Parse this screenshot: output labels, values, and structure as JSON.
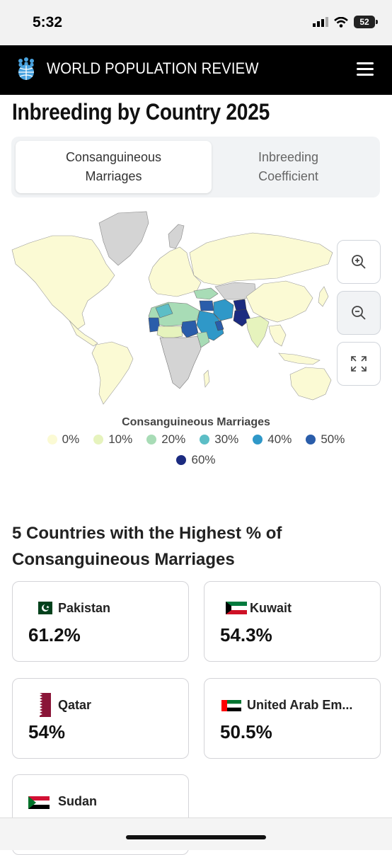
{
  "status": {
    "time": "5:32",
    "battery": "52"
  },
  "header": {
    "brand": "WORLD POPULATION REVIEW",
    "menu_icon": "hamburger-icon"
  },
  "page": {
    "title": "Inbreeding by Country 2025"
  },
  "tabs": [
    {
      "label": "Consanguineous Marriages",
      "active": true
    },
    {
      "label": "Inbreeding Coefficient",
      "active": false
    }
  ],
  "map": {
    "controls": [
      {
        "icon": "zoom-in-icon"
      },
      {
        "icon": "zoom-out-icon"
      },
      {
        "icon": "fullscreen-icon"
      }
    ],
    "legend": {
      "title": "Consanguineous Marriages",
      "items": [
        {
          "label": "0%",
          "color": "#fbfad4"
        },
        {
          "label": "10%",
          "color": "#e6f3bd"
        },
        {
          "label": "20%",
          "color": "#a8dcb6"
        },
        {
          "label": "30%",
          "color": "#5cbec6"
        },
        {
          "label": "40%",
          "color": "#2f98c8"
        },
        {
          "label": "50%",
          "color": "#2a5daa"
        },
        {
          "label": "60%",
          "color": "#1b2b80"
        }
      ]
    }
  },
  "section": {
    "heading": "5 Countries with the Highest % of Consanguineous Marriages",
    "countries": [
      {
        "name": "Pakistan",
        "value": "61.2%",
        "flag": "pakistan-flag"
      },
      {
        "name": "Kuwait",
        "value": "54.3%",
        "flag": "kuwait-flag"
      },
      {
        "name": "Qatar",
        "value": "54%",
        "flag": "qatar-flag"
      },
      {
        "name": "United Arab Em...",
        "value": "50.5%",
        "flag": "uae-flag"
      },
      {
        "name": "Sudan",
        "value": "",
        "flag": "sudan-flag"
      }
    ]
  }
}
